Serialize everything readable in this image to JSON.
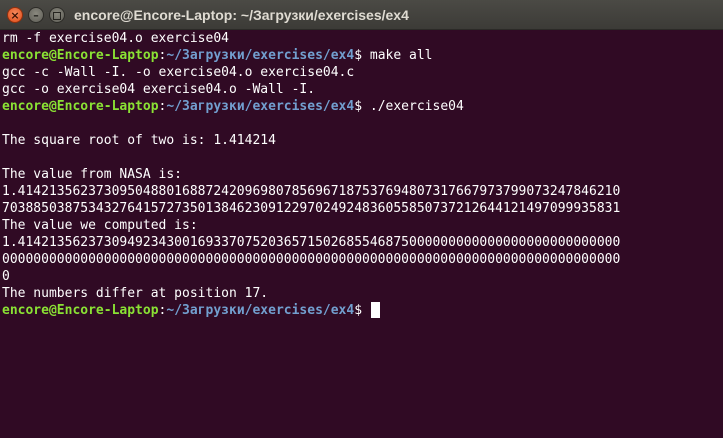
{
  "window": {
    "title": "encore@Encore-Laptop: ~/Загрузки/exercises/ex4",
    "close_glyph": "×"
  },
  "terminal": {
    "prompt_user": "encore@Encore-Laptop",
    "prompt_sep": ":",
    "prompt_path": "~/Загрузки/exercises/ex4",
    "prompt_dollar": "$",
    "lines": [
      {
        "type": "out",
        "text": "rm -f exercise04.o exercise04"
      },
      {
        "type": "prompt",
        "cmd": "make all"
      },
      {
        "type": "out",
        "text": "gcc -c -Wall -I. -o exercise04.o exercise04.c"
      },
      {
        "type": "out",
        "text": "gcc -o exercise04 exercise04.o -Wall -I."
      },
      {
        "type": "prompt",
        "cmd": "./exercise04"
      },
      {
        "type": "out",
        "text": ""
      },
      {
        "type": "out",
        "text": "The square root of two is: 1.414214"
      },
      {
        "type": "out",
        "text": ""
      },
      {
        "type": "out",
        "text": "The value from NASA is:"
      },
      {
        "type": "out",
        "text": "1.41421356237309504880168872420969807856967187537694807317667973799073247846210"
      },
      {
        "type": "out",
        "text": "7038850387534327641572735013846230912297024924836055850737212644121497099935831"
      },
      {
        "type": "out",
        "text": "The value we computed is:"
      },
      {
        "type": "out",
        "text": "1.41421356237309492343001693370752036571502685546875000000000000000000000000000"
      },
      {
        "type": "out",
        "text": "0000000000000000000000000000000000000000000000000000000000000000000000000000000"
      },
      {
        "type": "out",
        "text": "0"
      },
      {
        "type": "out",
        "text": "The numbers differ at position 17."
      },
      {
        "type": "prompt",
        "cmd": "",
        "cursor": true
      }
    ]
  }
}
